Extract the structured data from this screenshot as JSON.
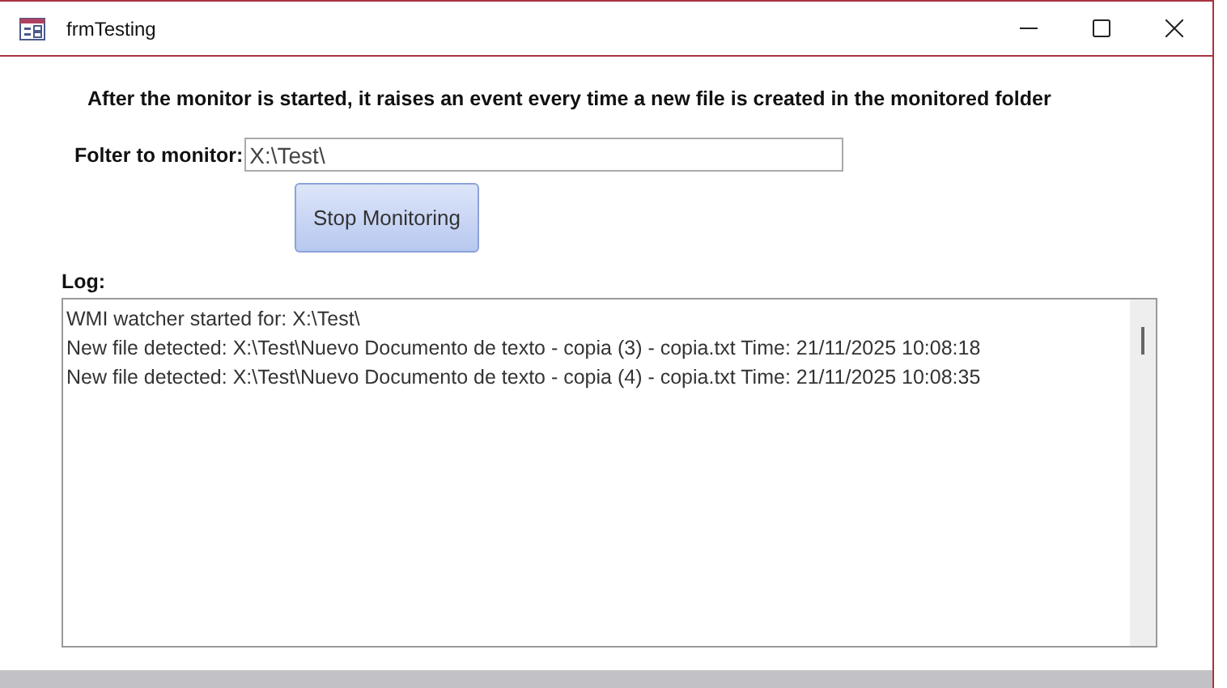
{
  "window": {
    "title": "frmTesting"
  },
  "heading": "After the monitor is started, it raises an event every time a new file is created in the monitored folder",
  "folder_field": {
    "label": "Folter to monitor:",
    "value": "X:\\Test\\"
  },
  "button": {
    "label": "Stop Monitoring"
  },
  "log": {
    "label": "Log:",
    "lines": [
      "WMI watcher started for: X:\\Test\\",
      "New file detected: X:\\Test\\Nuevo Documento de texto - copia (3) - copia.txt Time: 21/11/2025 10:08:18",
      "New file detected: X:\\Test\\Nuevo Documento de texto - copia (4) - copia.txt Time: 21/11/2025 10:08:35"
    ]
  }
}
